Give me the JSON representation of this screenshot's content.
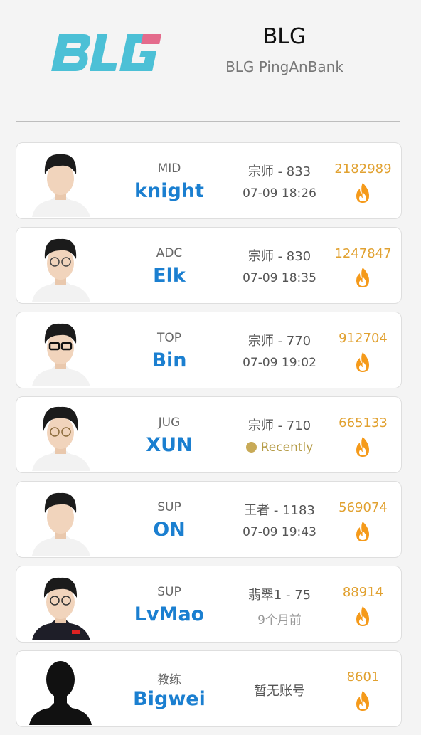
{
  "header": {
    "logo_alt": "BLG",
    "team_name": "BLG",
    "team_sub": "BLG PingAnBank"
  },
  "colors": {
    "accent_blue": "#1b7fd0",
    "hot_orange": "#e1a130",
    "flame": "#f59a1a",
    "logo_cyan": "#4cc0d6",
    "logo_pink": "#e46b8c"
  },
  "players": [
    {
      "role": "MID",
      "name": "knight",
      "rank": "宗师 - 833",
      "time": "07-09 18:26",
      "time_style": "normal",
      "hot": "2182989",
      "icon": "flame-icon"
    },
    {
      "role": "ADC",
      "name": "Elk",
      "rank": "宗师 - 830",
      "time": "07-09 18:35",
      "time_style": "normal",
      "hot": "1247847",
      "icon": "flame-icon"
    },
    {
      "role": "TOP",
      "name": "Bin",
      "rank": "宗师 - 770",
      "time": "07-09 19:02",
      "time_style": "normal",
      "hot": "912704",
      "icon": "flame-icon"
    },
    {
      "role": "JUG",
      "name": "XUN",
      "rank": "宗师 - 710",
      "time": "Recently",
      "time_style": "recent",
      "hot": "665133",
      "icon": "flame-icon"
    },
    {
      "role": "SUP",
      "name": "ON",
      "rank": "王者 - 1183",
      "time": "07-09 19:43",
      "time_style": "normal",
      "hot": "569074",
      "icon": "flame-icon"
    },
    {
      "role": "SUP",
      "name": "LvMao",
      "rank": "翡翠1 - 75",
      "time": "9个月前",
      "time_style": "gray",
      "hot": "88914",
      "icon": "flame-icon"
    },
    {
      "role": "教练",
      "name": "Bigwei",
      "rank": "暂无账号",
      "time": "",
      "time_style": "none",
      "hot": "8601",
      "icon": "flame-icon"
    }
  ]
}
